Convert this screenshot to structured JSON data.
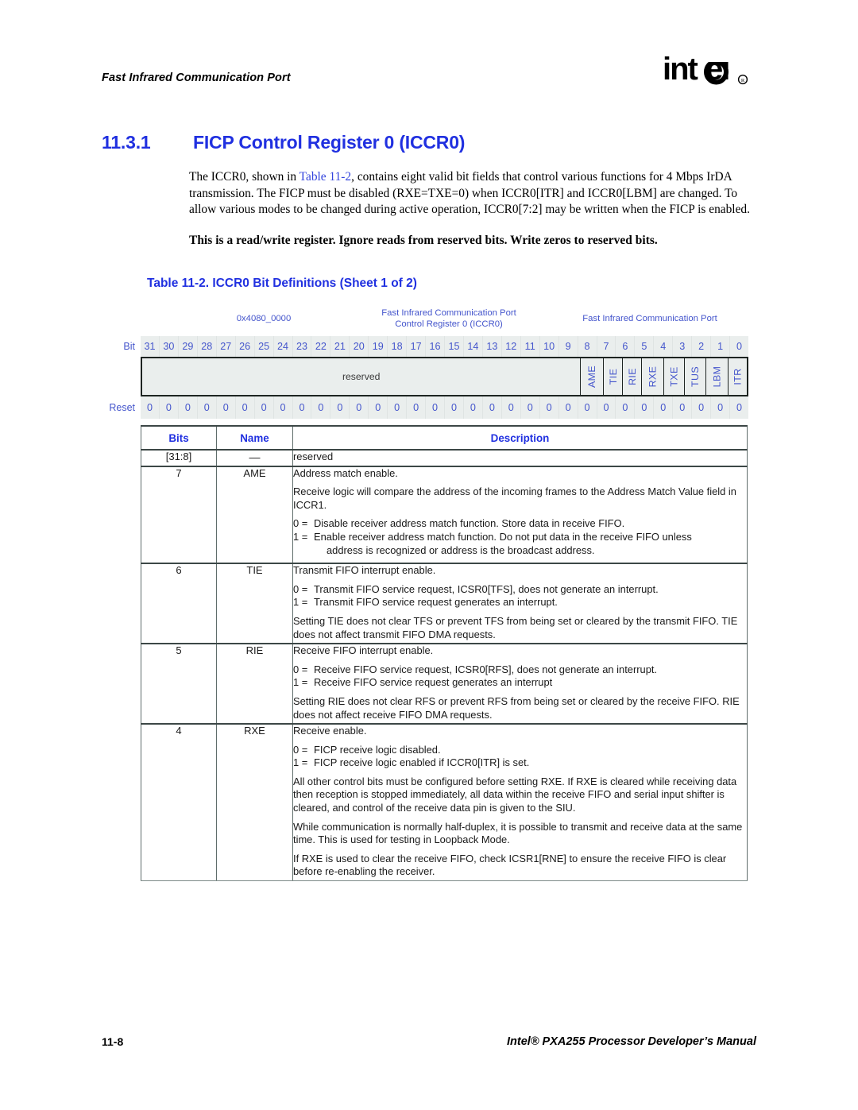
{
  "header": {
    "running_head": "Fast Infrared Communication Port",
    "logo_text": "intel",
    "logo_mark": "registered-trademark"
  },
  "section": {
    "number": "11.3.1",
    "title": "FICP Control Register 0 (ICCR0)"
  },
  "body": {
    "p1_a": "The ICCR0, shown in ",
    "p1_link": "Table 11-2",
    "p1_b": ", contains eight valid bit fields that control various functions for 4 Mbps IrDA transmission. The FICP must be disabled (RXE=TXE=0) when ICCR0[ITR] and ICCR0[LBM] are changed. To allow various modes to be changed during active operation, ICCR0[7:2] may be written when the FICP is enabled.",
    "p2_bold": "This is a read/write register. Ignore reads from reserved bits. Write zeros to reserved bits."
  },
  "table_caption": "Table 11-2. ICCR0 Bit Definitions (Sheet 1 of 2)",
  "register": {
    "address": "0x4080_0000",
    "name_line1": "Fast Infrared Communication Port",
    "name_line2": "Control Register 0 (ICCR0)",
    "unit": "Fast Infrared Communication Port",
    "bit_label": "Bit",
    "reset_label": "Reset",
    "bit_numbers": [
      "31",
      "30",
      "29",
      "28",
      "27",
      "26",
      "25",
      "24",
      "23",
      "22",
      "21",
      "20",
      "19",
      "18",
      "17",
      "16",
      "15",
      "14",
      "13",
      "12",
      "11",
      "10",
      "9",
      "8",
      "7",
      "6",
      "5",
      "4",
      "3",
      "2",
      "1",
      "0"
    ],
    "reserved_label": "reserved",
    "reserved_span": 24,
    "fields": [
      "AME",
      "TIE",
      "RIE",
      "RXE",
      "TXE",
      "TUS",
      "LBM",
      "ITR"
    ],
    "reset_values": [
      "0",
      "0",
      "0",
      "0",
      "0",
      "0",
      "0",
      "0",
      "0",
      "0",
      "0",
      "0",
      "0",
      "0",
      "0",
      "0",
      "0",
      "0",
      "0",
      "0",
      "0",
      "0",
      "0",
      "0",
      "0",
      "0",
      "0",
      "0",
      "0",
      "0",
      "0",
      "0"
    ]
  },
  "bit_table": {
    "headers": [
      "Bits",
      "Name",
      "Description"
    ],
    "rows": [
      {
        "bits": "[31:8]",
        "name": "—",
        "blocks": [
          {
            "kind": "text",
            "text": "reserved"
          }
        ]
      },
      {
        "bits": "7",
        "name": "AME",
        "blocks": [
          {
            "kind": "text",
            "text": "Address match enable."
          },
          {
            "kind": "text",
            "text": "Receive logic will compare the address of the incoming frames to the Address Match Value field in ICCR1."
          },
          {
            "kind": "list",
            "items": [
              {
                "key": "0 =",
                "value": "Disable receiver address match function. Store data in receive FIFO.",
                "cont": ""
              },
              {
                "key": "1 =",
                "value": "Enable receiver address match function. Do not put data in the receive FIFO unless",
                "cont": "address is recognized or address is the broadcast address."
              }
            ]
          }
        ]
      },
      {
        "bits": "6",
        "name": "TIE",
        "blocks": [
          {
            "kind": "text",
            "text": "Transmit FIFO interrupt enable."
          },
          {
            "kind": "list",
            "items": [
              {
                "key": "0 =",
                "value": "Transmit FIFO service request, ICSR0[TFS], does not generate an interrupt.",
                "cont": ""
              },
              {
                "key": "1 =",
                "value": "Transmit FIFO service request generates an interrupt.",
                "cont": ""
              }
            ]
          },
          {
            "kind": "text",
            "text": "Setting TIE does not clear TFS or prevent TFS from being set or cleared by the transmit FIFO. TIE does not affect transmit FIFO DMA requests."
          }
        ]
      },
      {
        "bits": "5",
        "name": "RIE",
        "blocks": [
          {
            "kind": "text",
            "text": "Receive FIFO interrupt enable."
          },
          {
            "kind": "list",
            "items": [
              {
                "key": "0 =",
                "value": "Receive FIFO service request, ICSR0[RFS], does not generate an interrupt.",
                "cont": ""
              },
              {
                "key": "1 =",
                "value": "Receive FIFO service request generates an interrupt",
                "cont": ""
              }
            ]
          },
          {
            "kind": "text",
            "text": "Setting RIE does not clear RFS or prevent RFS from being set or cleared by the receive FIFO. RIE does not affect receive FIFO DMA requests."
          }
        ]
      },
      {
        "bits": "4",
        "name": "RXE",
        "blocks": [
          {
            "kind": "text",
            "text": "Receive enable."
          },
          {
            "kind": "list",
            "items": [
              {
                "key": "0 =",
                "value": "FICP receive logic disabled.",
                "cont": ""
              },
              {
                "key": "1 =",
                "value": "FICP receive logic enabled if ICCR0[ITR] is set.",
                "cont": ""
              }
            ]
          },
          {
            "kind": "text",
            "text": "All other control bits must be configured before setting RXE. If RXE is cleared while receiving data then reception is stopped immediately, all data within the receive FIFO and serial input shifter is cleared, and control of the receive data pin is given to the SIU."
          },
          {
            "kind": "text",
            "text": "While communication is normally half-duplex, it is possible to transmit and receive data at the same time. This is used for testing in Loopback Mode."
          },
          {
            "kind": "text",
            "text": "If RXE is used to clear the receive FIFO, check ICSR1[RNE] to ensure the receive FIFO is clear before re-enabling the receiver."
          }
        ]
      }
    ]
  },
  "footer": {
    "folio": "11-8",
    "title": "Intel® PXA255 Processor Developer’s Manual"
  },
  "colors": {
    "heading_blue": "#2030e0",
    "label_blue": "#4455cc",
    "link_blue": "#3344dd",
    "reg_bg": "#eaeeed",
    "rule": "#5f6d6b"
  }
}
